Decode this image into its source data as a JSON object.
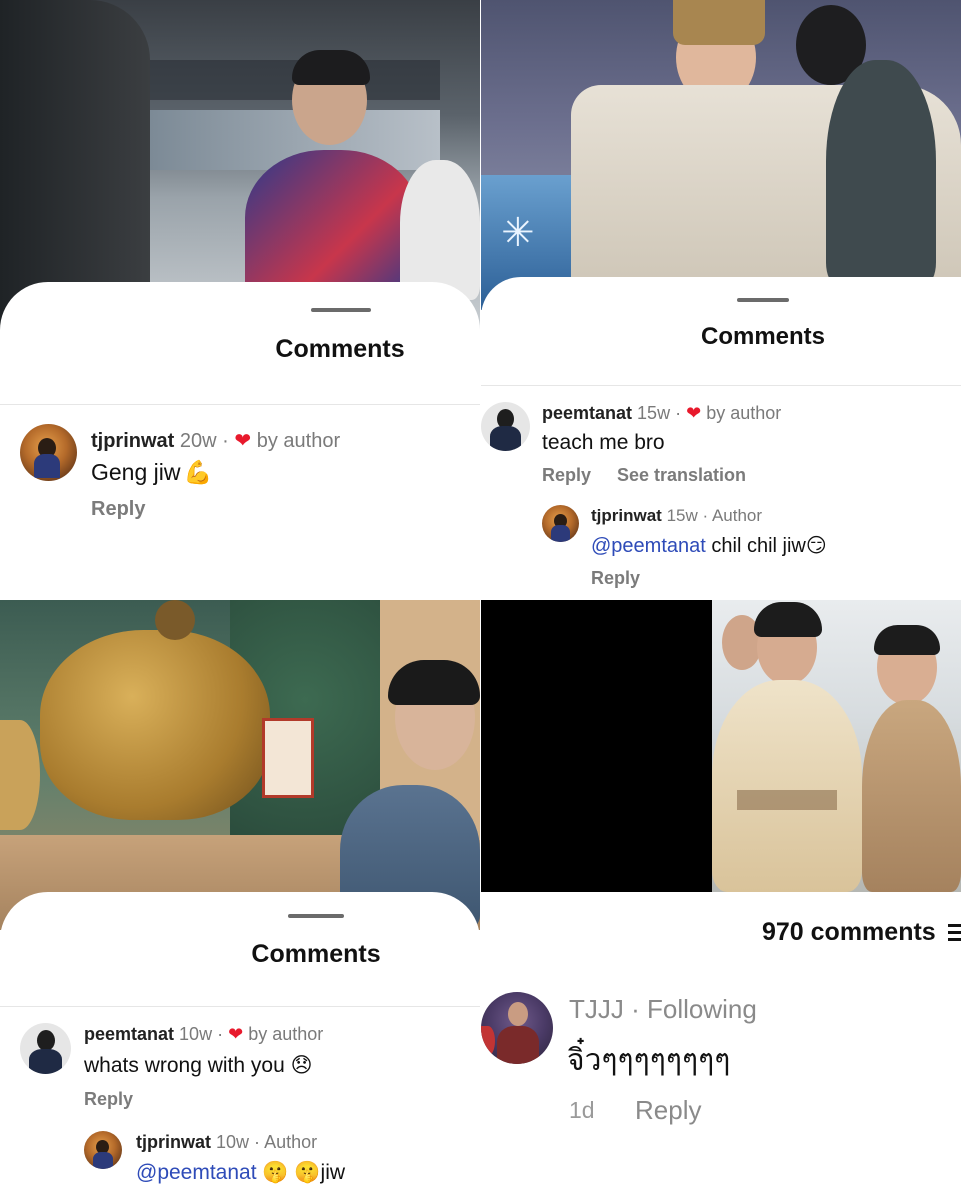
{
  "panels": [
    {
      "sheet_title": "Comments",
      "comment": {
        "username": "tjprinwat",
        "age": "20w",
        "badge": "by author",
        "text": "Geng jiw",
        "emoji": "💪",
        "reply": "Reply"
      }
    },
    {
      "sheet_title": "Comments",
      "comment": {
        "username": "peemtanat",
        "age": "15w",
        "badge": "by author",
        "text": "teach me bro",
        "reply": "Reply",
        "translate": "See translation"
      },
      "subreply": {
        "username": "tjprinwat",
        "age": "15w",
        "badge": "Author",
        "mention": "@peemtanat",
        "text": "chil chil jiw",
        "emoji": "😏",
        "reply": "Reply"
      }
    },
    {
      "sheet_title": "Comments",
      "comment": {
        "username": "peemtanat",
        "age": "10w",
        "badge": "by author",
        "text": "whats wrong with you",
        "emoji": "😞",
        "reply": "Reply"
      },
      "subreply": {
        "username": "tjprinwat",
        "age": "10w",
        "badge": "Author",
        "mention": "@peemtanat",
        "emoji": "🤫 🤫",
        "text": "jiw"
      }
    },
    {
      "comment_count": "970 comments",
      "comment": {
        "username": "TJJJ",
        "status": "Following",
        "text": "จิ๋วๆๆๆๆๆๆๆๆ",
        "age": "1d",
        "reply": "Reply"
      }
    }
  ],
  "colors": {
    "heart": "#e8192c",
    "mention": "#2e4bb8",
    "muted": "#7a7a7a"
  },
  "icons": [
    "heart-icon",
    "flexed-biceps-emoji",
    "smirk-emoji",
    "disappointed-emoji",
    "shushing-emoji"
  ]
}
